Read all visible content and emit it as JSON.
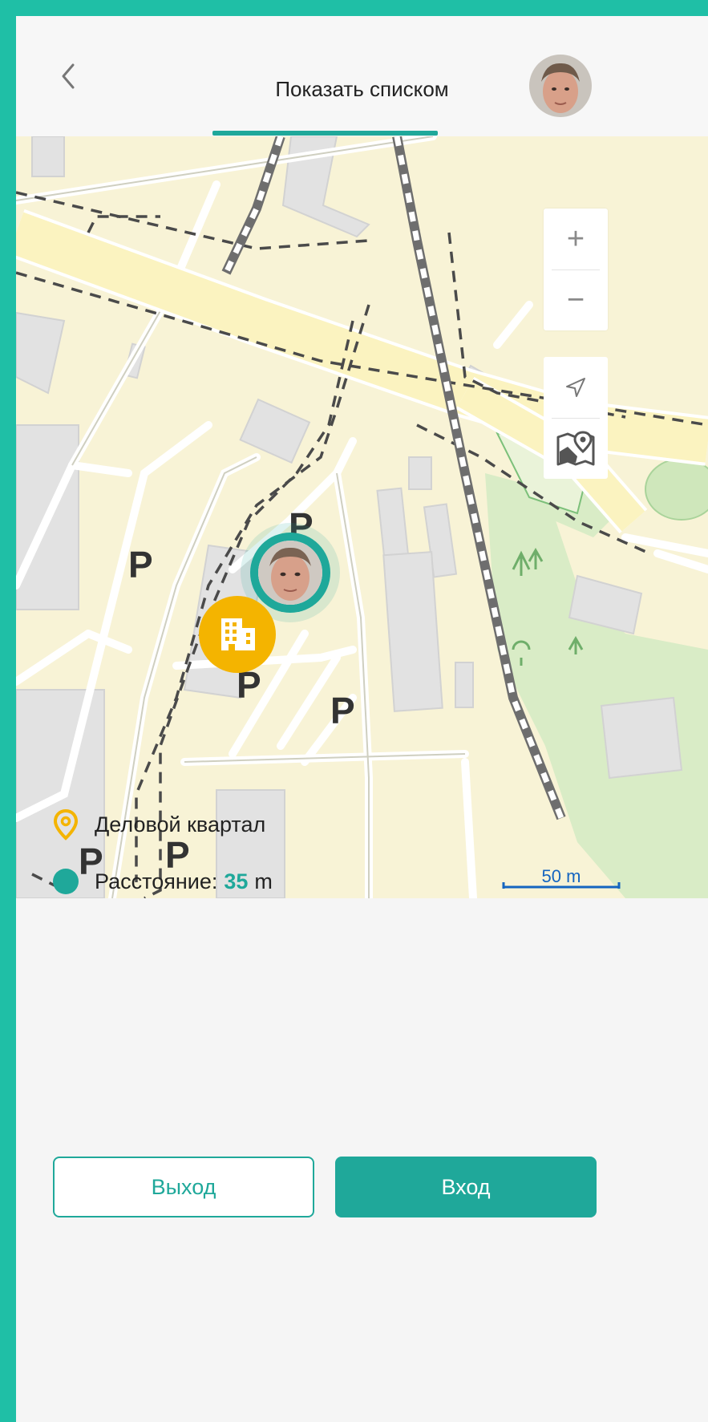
{
  "header": {
    "title": "Показать списком"
  },
  "map": {
    "zoom_in_label": "+",
    "zoom_out_label": "−",
    "scale_label": "50 m",
    "parking_label": "P"
  },
  "info": {
    "place_name": "Деловой квартал",
    "distance_label": "Расстояние:",
    "distance_value": "35",
    "distance_unit": "m"
  },
  "buttons": {
    "exit_label": "Выход",
    "enter_label": "Вход"
  },
  "colors": {
    "accent": "#1fa89a",
    "marker_yellow": "#f4b400",
    "frame": "#1fbfa6"
  }
}
